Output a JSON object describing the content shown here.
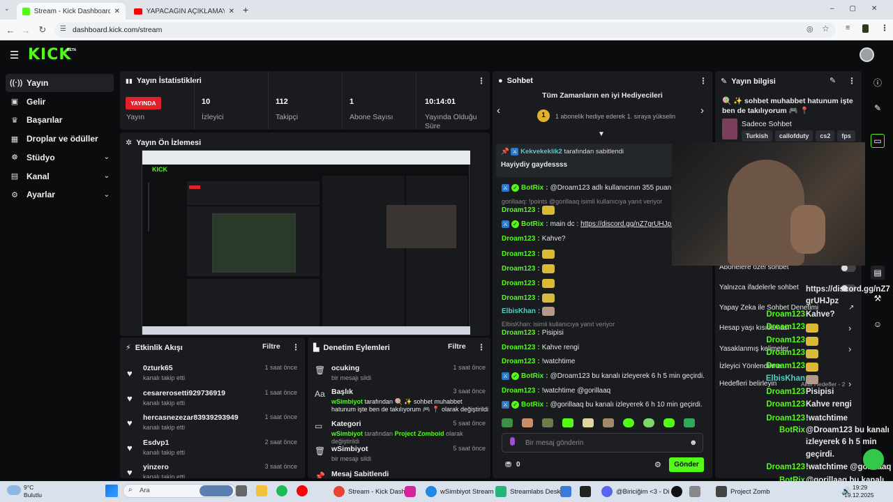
{
  "browser": {
    "tabs": [
      {
        "label": "Stream - Kick Dashboard",
        "active": true
      },
      {
        "label": "YAPACAĞIN AÇIKLAMAYI S- - Yo",
        "active": false
      }
    ],
    "url": "dashboard.kick.com/stream"
  },
  "kick": {
    "logo": "KICK",
    "logo_sup": "BETA"
  },
  "sidebar": {
    "items": [
      {
        "label": "Yayın",
        "icon": "broadcast-icon",
        "glyph": "((·))",
        "selected": true,
        "expandable": false
      },
      {
        "label": "Gelir",
        "icon": "revenue-icon",
        "glyph": "▣",
        "selected": false,
        "expandable": false
      },
      {
        "label": "Başarılar",
        "icon": "trophy-icon",
        "glyph": "♛",
        "selected": false,
        "expandable": false
      },
      {
        "label": "Droplar ve ödüller",
        "icon": "gift-icon",
        "glyph": "▦",
        "selected": false,
        "expandable": false
      },
      {
        "label": "Stüdyo",
        "icon": "studio-icon",
        "glyph": "☸",
        "selected": false,
        "expandable": true
      },
      {
        "label": "Kanal",
        "icon": "channel-icon",
        "glyph": "▤",
        "selected": false,
        "expandable": true
      },
      {
        "label": "Ayarlar",
        "icon": "settings-icon",
        "glyph": "⚙",
        "selected": false,
        "expandable": true
      }
    ]
  },
  "stats": {
    "title": "Yayın İstatistikleri",
    "live_badge": "YAYINDA",
    "items": [
      {
        "value": "",
        "label": "Yayın"
      },
      {
        "value": "10",
        "label": "İzleyici"
      },
      {
        "value": "112",
        "label": "Takipçi"
      },
      {
        "value": "1",
        "label": "Abone Sayısı"
      },
      {
        "value": "10:14:01",
        "label": "Yayında Olduğu Süre"
      }
    ]
  },
  "preview": {
    "title": "Yayın Ön İzlemesi"
  },
  "activity": {
    "title": "Etkinlik Akışı",
    "filter": "Filtre",
    "items": [
      {
        "name": "0zturk65",
        "sub": "kanalı takip etti",
        "time": "1 saat önce"
      },
      {
        "name": "cesarerosetti929736919",
        "sub": "kanalı takip etti",
        "time": "1 saat önce"
      },
      {
        "name": "hercasnezezar83939293949",
        "sub": "kanalı takip etti",
        "time": "1 saat önce"
      },
      {
        "name": "Esdvp1",
        "sub": "kanalı takip etti",
        "time": "2 saat önce"
      },
      {
        "name": "yinzero",
        "sub": "kanalı takip etti",
        "time": "3 saat önce"
      }
    ]
  },
  "moderation": {
    "title": "Denetim Eylemleri",
    "filter": "Filtre",
    "items": [
      {
        "name": "ocuking",
        "pre": "",
        "sub": "bir mesajı sildi",
        "post": "",
        "time": "1 saat önce",
        "icon": "trash-icon",
        "glyph": "🗑"
      },
      {
        "name": "Başlık",
        "pre": "wSimbiyot",
        "sub": " tarafından 🍭 ✨ sohbet muhabbet hatunum işte ben de takılıyorum 🎮 📍 olarak değiştirildi",
        "post": "",
        "time": "3 saat önce",
        "icon": "title-icon",
        "glyph": "Aa"
      },
      {
        "name": "Kategori",
        "pre": "wSimbiyot",
        "sub": " tarafından ",
        "post": "Project Zomboid",
        "post2": " olarak değiştirildi",
        "time": "5 saat önce",
        "icon": "category-icon",
        "glyph": "▭"
      },
      {
        "name": "wSimbiyot",
        "pre": "",
        "sub": "bir mesajı sildi",
        "post": "",
        "time": "5 saat önce",
        "icon": "trash-icon",
        "glyph": "🗑"
      },
      {
        "name": "Mesaj Sabitlendi",
        "pre": "",
        "sub": "",
        "post": "",
        "time": "",
        "icon": "pin-icon",
        "glyph": "📌"
      }
    ]
  },
  "chat": {
    "title": "Sohbet",
    "gifters_title": "Tüm Zamanların en iyi Hediyecileri",
    "gifters_sub": "1 abonelik hediye ederek 1. sıraya yükselin",
    "gifters_rank": "1",
    "pinned_by": "Kekvekeklik2",
    "pinned_suffix": "tarafından sabitlendi",
    "pinned_msg": "Hayiydiy gaydessss",
    "lines": [
      {
        "user": "BotRix",
        "color": "#53fc18",
        "bot": true,
        "text": "@Droam123 adlı kullanıcının 355 puanı var."
      },
      {
        "sys": "gorillaaq: !points @gorillaaq isimli kullanıcıya yanıt veriyor"
      },
      {
        "user": "Droam123",
        "color": "#53fc18",
        "text": "",
        "emote": true
      },
      {
        "user": "BotRix",
        "color": "#53fc18",
        "bot": true,
        "text": "main dc : ",
        "link": "https://discord.gg/nZ7grUHJpz"
      },
      {
        "user": "Droam123",
        "color": "#53fc18",
        "text": "Kahve?"
      },
      {
        "user": "Droam123",
        "color": "#53fc18",
        "text": "",
        "emote": true
      },
      {
        "user": "Droam123",
        "color": "#53fc18",
        "text": "",
        "emote": true
      },
      {
        "user": "Droam123",
        "color": "#53fc18",
        "text": "",
        "emote": true
      },
      {
        "user": "Droam123",
        "color": "#53fc18",
        "text": "",
        "emote": true
      },
      {
        "user": "ElbisKhan",
        "color": "#4fd1c5",
        "text": "",
        "emote": true
      },
      {
        "sys": "ElbisKhan: isimli kullanıcıya yanıt veriyor"
      },
      {
        "user": "Droam123",
        "color": "#53fc18",
        "text": "Pisipisi"
      },
      {
        "user": "Droam123",
        "color": "#53fc18",
        "text": "Kahve rengi"
      },
      {
        "user": "Droam123",
        "color": "#53fc18",
        "text": "!watchtime"
      },
      {
        "user": "BotRix",
        "color": "#53fc18",
        "bot": true,
        "text": "@Droam123 bu kanalı izleyerek 6 h 5 min geçirdi."
      },
      {
        "user": "Droam123",
        "color": "#53fc18",
        "text": "!watchtime @gorillaaq"
      },
      {
        "user": "BotRix",
        "color": "#53fc18",
        "bot": true,
        "text": "@gorillaaq bu kanalı izleyerek 6 h 10 min geçirdi."
      }
    ],
    "input_placeholder": "Bir mesaj gönderin",
    "points": "0",
    "send": "Gönder"
  },
  "info": {
    "title": "Yayın bilgisi",
    "stream_title": "🍭 ✨ sohbet muhabbet hatunum işte ben de takılıyorum 🎮 📍",
    "category": "Sadece Sohbet",
    "tags": [
      "Turkish",
      "callofduty",
      "cs2",
      "fps"
    ],
    "settings": [
      {
        "label": "Abonelere özel sohbet",
        "control": "toggle"
      },
      {
        "label": "Yalnızca ifadelerle sohbet",
        "control": "toggle"
      },
      {
        "label": "Yapay Zeka ile Sohbet Denetimi",
        "control": "external"
      },
      {
        "label": "Hesap yaşı kısıtlaması",
        "control": "chevron"
      },
      {
        "label": "Yasaklanmış kelimeler",
        "control": "chevron"
      },
      {
        "label": "İzleyici Yönlendirme",
        "control": "none"
      },
      {
        "label": "Hedefleri belirleyin",
        "control": "chevron",
        "extra": "Aktif Hedefler - 2"
      }
    ]
  },
  "overlay_chat": [
    {
      "user": "",
      "text": "https://discord.gg/nZ7"
    },
    {
      "user": "",
      "text": "grUHJpz"
    },
    {
      "user": "Droam123",
      "text": "Kahve?"
    },
    {
      "user": "Droam123",
      "text": "",
      "emote": true
    },
    {
      "user": "Droam123",
      "text": "",
      "emote": true
    },
    {
      "user": "Droam123",
      "text": "",
      "emote": true
    },
    {
      "user": "Droam123",
      "text": "",
      "emote": true
    },
    {
      "user": "ElbisKhan",
      "text": "",
      "emote": true
    },
    {
      "user": "Droam123",
      "text": "Pisipisi"
    },
    {
      "user": "Droam123",
      "text": "Kahve rengi"
    },
    {
      "user": "Droam123",
      "text": "!watchtime"
    },
    {
      "user": "BotRix",
      "text": "@Droam123 bu kanalı"
    },
    {
      "user": "",
      "text": "izleyerek 6 h 5 min"
    },
    {
      "user": "",
      "text": "geçirdi."
    },
    {
      "user": "Droam123",
      "text": "!watchtime @gorillaaq"
    },
    {
      "user": "BotRix",
      "text": "@gorillaaq bu kanalı"
    },
    {
      "user": "",
      "text": "izleyerek 6 h 10 min"
    },
    {
      "user": "",
      "text": "geçirdi."
    }
  ],
  "taskbar": {
    "weather_temp": "9°C",
    "weather_desc": "Bulutlu",
    "search": "Ara",
    "apps": [
      {
        "label": "Stream - Kick Dash",
        "color": "#ea4335"
      },
      {
        "label": "wSimbiyot Stream",
        "color": "#1e88e5"
      },
      {
        "label": "Streamlabs Desk",
        "color": "#2ab27b"
      },
      {
        "label": "@Biriciğim <3 - Di",
        "color": "#5865f2"
      },
      {
        "label": "Project Zomb",
        "color": "#444444"
      }
    ],
    "time": "19:29",
    "date": "19.12.2025"
  },
  "colors": {
    "accent": "#53fc18",
    "live": "#e0212b",
    "panel": "#191b1f",
    "bg": "#0b0c0d"
  }
}
